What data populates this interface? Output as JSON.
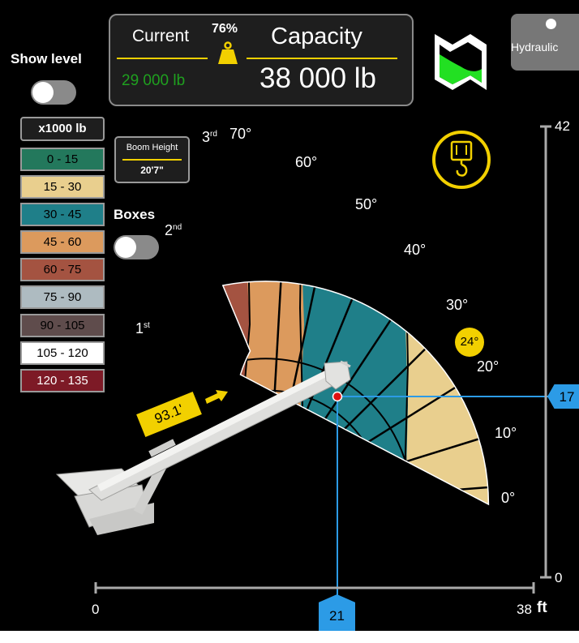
{
  "header": {
    "current_label": "Current",
    "current_value": "29 000 lb",
    "percent": "76%",
    "capacity_label": "Capacity",
    "capacity_value": "38 000 lb"
  },
  "hydraulic_button": {
    "label": "Hydraulic"
  },
  "show_level": {
    "label": "Show level"
  },
  "boxes": {
    "label": "Boxes"
  },
  "boom_height": {
    "label": "Boom Height",
    "value": "20'7\""
  },
  "legend": {
    "header": "x1000 lb",
    "items": [
      {
        "label": "0 - 15",
        "color": "#23785c",
        "text_color": "#000000"
      },
      {
        "label": "15 - 30",
        "color": "#e9cf8e",
        "text_color": "#000000"
      },
      {
        "label": "30 - 45",
        "color": "#1f7f89",
        "text_color": "#000000"
      },
      {
        "label": "45 - 60",
        "color": "#dc9a5d",
        "text_color": "#000000"
      },
      {
        "label": "60 - 75",
        "color": "#a45341",
        "text_color": "#000000"
      },
      {
        "label": "75 - 90",
        "color": "#aebbc1",
        "text_color": "#000000"
      },
      {
        "label": "90 - 105",
        "color": "#5f4c4c",
        "text_color": "#000000"
      },
      {
        "label": "105 - 120",
        "color": "#ffffff",
        "text_color": "#000000"
      },
      {
        "label": "120 - 135",
        "color": "#7d1a26",
        "text_color": "#ffffff"
      }
    ]
  },
  "chart": {
    "angle_labels": [
      "0°",
      "10°",
      "20°",
      "30°",
      "40°",
      "50°",
      "60°",
      "70°"
    ],
    "extension_labels": {
      "first": "1",
      "first_sup": "st",
      "second": "2",
      "second_sup": "nd",
      "third": "3",
      "third_sup": "rd"
    },
    "current_angle": "24°",
    "boom_length": "93.1'",
    "x_axis": {
      "min_label": "0",
      "max_label": "38",
      "unit": "ft",
      "marker": "21"
    },
    "y_axis": {
      "min_label": "0",
      "max_label": "42",
      "marker": "17"
    }
  },
  "colors": {
    "accent_yellow": "#f2d000",
    "marker_blue": "#2c9be6",
    "current_green": "#1fa01f",
    "map_green": "#22e022"
  },
  "icons": [
    "weight-icon",
    "map-icon",
    "hook-icon",
    "arrow-icon"
  ]
}
